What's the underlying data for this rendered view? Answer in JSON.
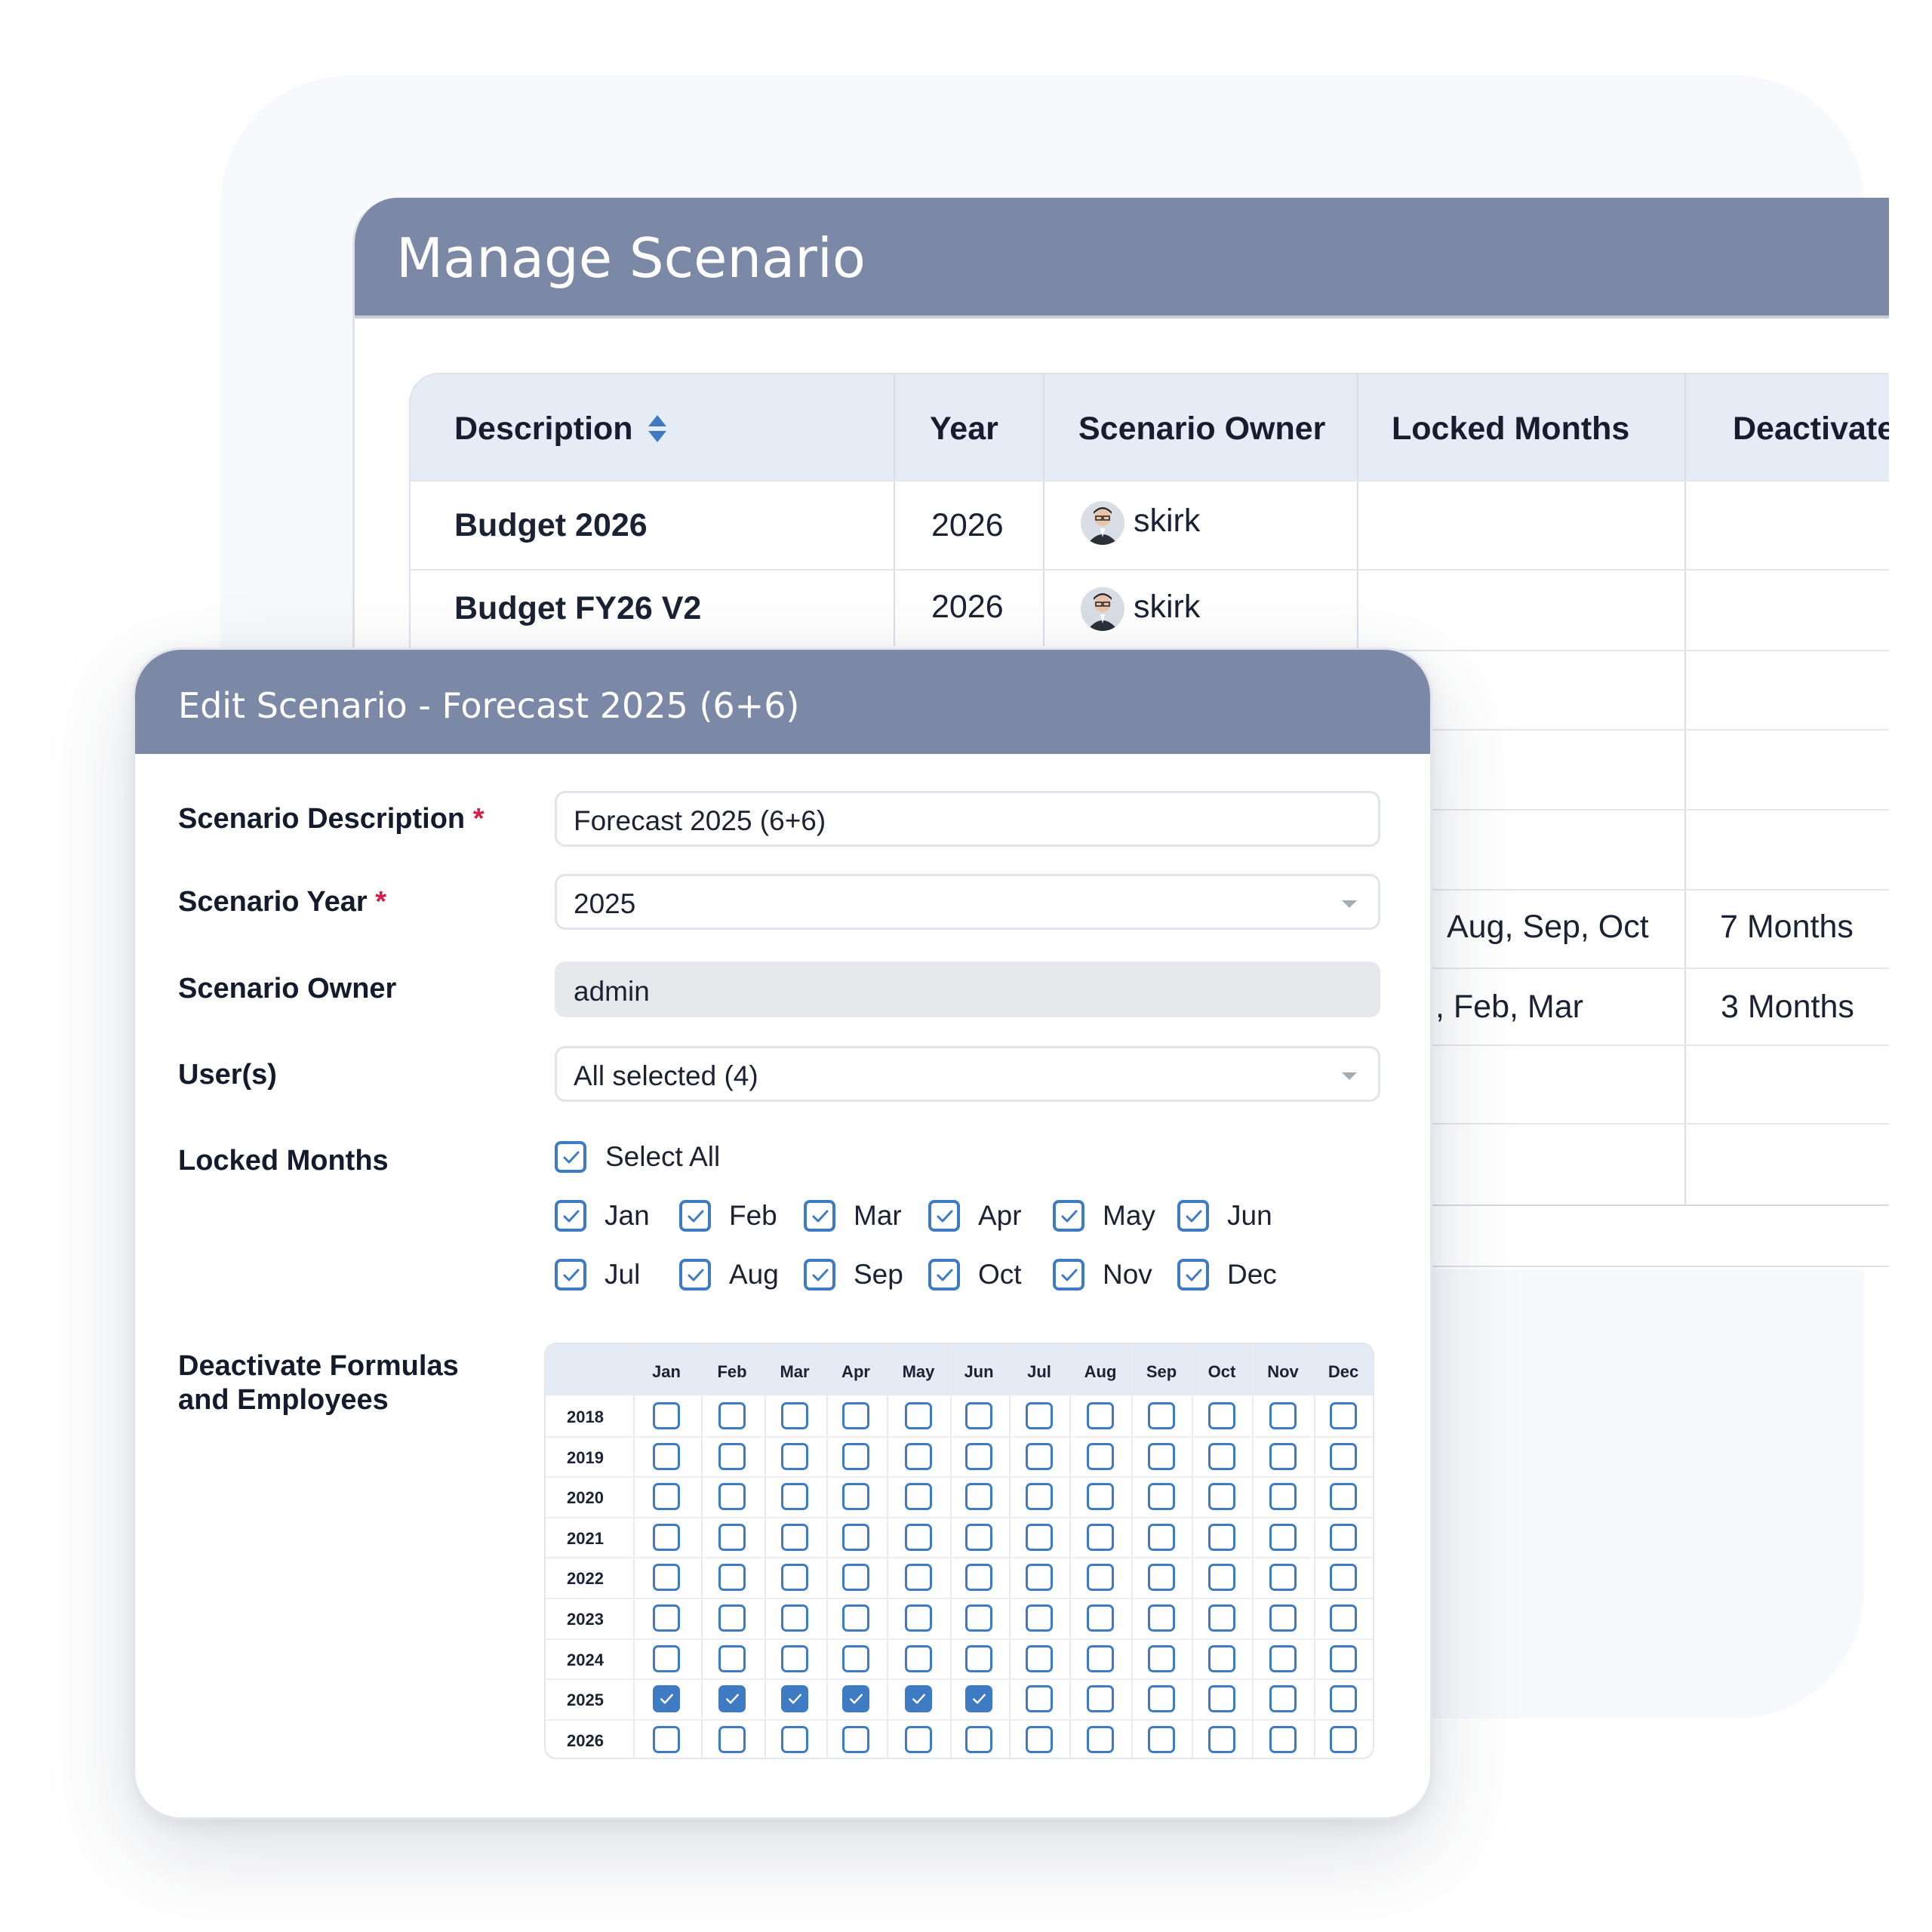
{
  "manage": {
    "title": "Manage Scenario",
    "columns": {
      "description": "Description",
      "year": "Year",
      "owner": "Scenario Owner",
      "locked": "Locked Months",
      "deactivate": "Deactivate"
    },
    "rows": [
      {
        "description": "Budget 2026",
        "year": "2026",
        "owner": "skirk"
      },
      {
        "description": "Budget FY26 V2",
        "year": "2026",
        "owner": "skirk"
      }
    ],
    "partial_rows": [
      {
        "locked": "Aug, Sep, Oct",
        "deactivate": "7 Months"
      },
      {
        "locked": ", Feb, Mar",
        "deactivate": "3 Months"
      }
    ]
  },
  "modal": {
    "title": "Edit Scenario - Forecast 2025 (6+6)",
    "fields": {
      "description_label": "Scenario Description",
      "description_value": "Forecast 2025 (6+6)",
      "year_label": "Scenario Year",
      "year_value": "2025",
      "owner_label": "Scenario Owner",
      "owner_value": "admin",
      "users_label": "User(s)",
      "users_value": "All selected (4)",
      "required_mark": "*"
    },
    "locked_months": {
      "label": "Locked Months",
      "select_all": "Select All",
      "select_all_checked": true,
      "months": [
        {
          "label": "Jan",
          "checked": true
        },
        {
          "label": "Feb",
          "checked": true
        },
        {
          "label": "Mar",
          "checked": true
        },
        {
          "label": "Apr",
          "checked": true
        },
        {
          "label": "May",
          "checked": true
        },
        {
          "label": "Jun",
          "checked": true
        },
        {
          "label": "Jul",
          "checked": true
        },
        {
          "label": "Aug",
          "checked": true
        },
        {
          "label": "Sep",
          "checked": true
        },
        {
          "label": "Oct",
          "checked": true
        },
        {
          "label": "Nov",
          "checked": true
        },
        {
          "label": "Dec",
          "checked": true
        }
      ]
    },
    "deactivate": {
      "label_line1": "Deactivate Formulas",
      "label_line2": "and Employees",
      "months": [
        "Jan",
        "Feb",
        "Mar",
        "Apr",
        "May",
        "Jun",
        "Jul",
        "Aug",
        "Sep",
        "Oct",
        "Nov",
        "Dec"
      ],
      "years": [
        "2018",
        "2019",
        "2020",
        "2021",
        "2022",
        "2023",
        "2024",
        "2025",
        "2026"
      ],
      "checked": {
        "2025": [
          "Jan",
          "Feb",
          "Mar",
          "Apr",
          "May",
          "Jun"
        ]
      }
    }
  },
  "colors": {
    "header": "#7b89a6",
    "table_header": "#e6ecf6",
    "checkbox": "#3f7bc3",
    "required": "#d2204e"
  }
}
